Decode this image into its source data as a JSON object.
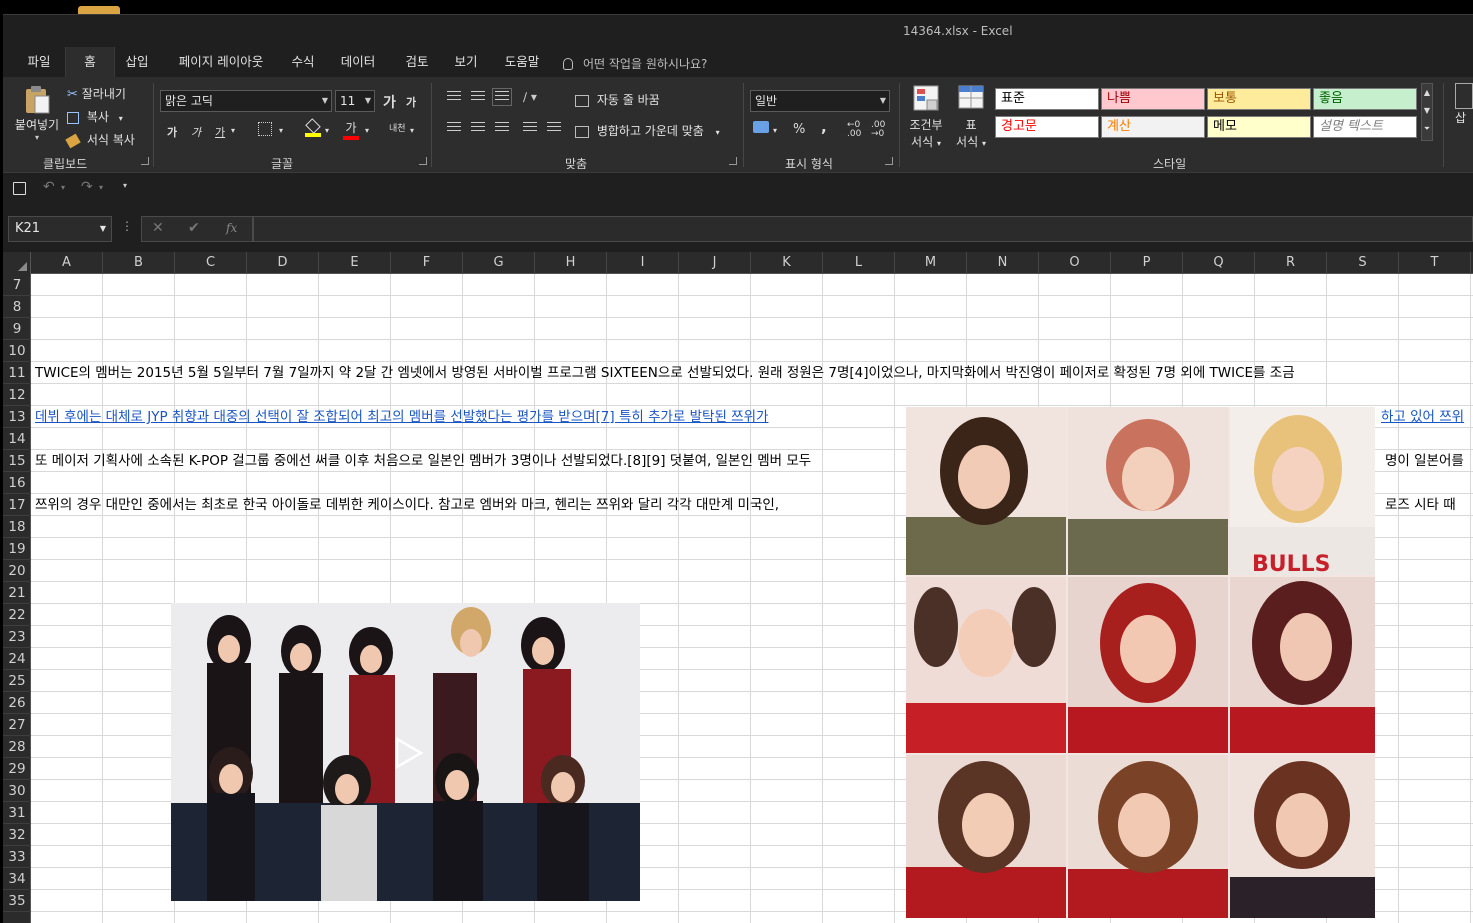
{
  "window": {
    "title": "14364.xlsx  -  Excel"
  },
  "tabs": [
    {
      "label": "파일",
      "active": false
    },
    {
      "label": "홈",
      "active": true
    },
    {
      "label": "삽입",
      "active": false
    },
    {
      "label": "페이지 레이아웃",
      "active": false
    },
    {
      "label": "수식",
      "active": false
    },
    {
      "label": "데이터",
      "active": false
    },
    {
      "label": "검토",
      "active": false
    },
    {
      "label": "보기",
      "active": false
    },
    {
      "label": "도움말",
      "active": false
    }
  ],
  "tell_me": "어떤 작업을 원하시나요?",
  "ribbon": {
    "clipboard": {
      "label": "클립보드",
      "paste": "붙여넣기",
      "cut": "잘라내기",
      "copy": "복사",
      "format_painter": "서식 복사"
    },
    "font": {
      "label": "글꼴",
      "font_name": "맑은 고딕",
      "font_size": "11",
      "grow": "가",
      "shrink": "가",
      "bold": "가",
      "italic": "가",
      "underline": "가",
      "font_color_glyph": "가",
      "phonetic": "내천"
    },
    "alignment": {
      "label": "맞춤",
      "wrap_text": "자동 줄 바꿈",
      "merge_center": "병합하고 가운데 맞춤"
    },
    "number": {
      "label": "표시 형식",
      "format": "일반",
      "percent": "%",
      "comma": ","
    },
    "styles": {
      "label": "스타일",
      "conditional": "조건부",
      "conditional2": "서식",
      "table": "표",
      "table2": "서식",
      "cells": [
        {
          "label": "표준",
          "bg": "#ffffff",
          "fg": "#000000"
        },
        {
          "label": "나쁨",
          "bg": "#ffc7ce",
          "fg": "#9c0006"
        },
        {
          "label": "보통",
          "bg": "#ffeb9c",
          "fg": "#9c5700"
        },
        {
          "label": "좋음",
          "bg": "#c6efce",
          "fg": "#006100"
        },
        {
          "label": "경고문",
          "bg": "#ffffff",
          "fg": "#ff0000"
        },
        {
          "label": "계산",
          "bg": "#f2f2f2",
          "fg": "#fa7d00"
        },
        {
          "label": "메모",
          "bg": "#ffffcc",
          "fg": "#000000"
        },
        {
          "label": "설명 텍스트",
          "bg": "#ffffff",
          "fg": "#7f7f7f"
        }
      ]
    },
    "cells_group": {
      "insert": "삽"
    }
  },
  "formula_bar": {
    "name_box": "K21",
    "fx": "fx",
    "value": ""
  },
  "columns": [
    "A",
    "B",
    "C",
    "D",
    "E",
    "F",
    "G",
    "H",
    "I",
    "J",
    "K",
    "L",
    "M",
    "N",
    "O",
    "P",
    "Q",
    "R",
    "S",
    "T"
  ],
  "rows": [
    "7",
    "8",
    "9",
    "10",
    "11",
    "12",
    "13",
    "14",
    "15",
    "16",
    "17",
    "18",
    "19",
    "20",
    "21",
    "22",
    "23",
    "24",
    "25",
    "26",
    "27",
    "28",
    "29",
    "30",
    "31",
    "32",
    "33",
    "34",
    "35"
  ],
  "cells": {
    "r11": "TWICE의 멤버는 2015년 5월 5일부터 7월 7일까지 약 2달 간 엠넷에서 방영된 서바이벌 프로그램 SIXTEEN으로 선발되었다. 원래 정원은 7명[4]이었으나, 마지막화에서 박진영이 페이저로 확정된 7명 외에 TWICE를 조금",
    "r13a": "데뷔 후에는 대체로 JYP 취향과 대중의 선택이 잘 조합되어 최고의 멤버를 선발했다는 평가를 받으며[7] 특히 추가로 발탁된 쯔위가",
    "r13b": "하고 있어 쯔위",
    "r15a": "또 메이저 기획사에 소속된 K-POP 걸그룹 중에선 써클 이후 처음으로 일본인 멤버가 3명이나 선발되었다.[8][9] 덧붙여, 일본인 멤버 모두",
    "r15b": "명이 일본어를",
    "r17a": "쯔위의 경우 대만인 중에서는 최초로 한국 아이돌로 데뷔한 케이스이다. 참고로 엠버와 마크, 헨리는 쯔위와 달리 각각 대만계 미국인,",
    "r17b": "로즈 시타 때"
  },
  "colors": {
    "accent": "#217346",
    "link": "#1a55c4",
    "font_color_bar": "#ff0000",
    "highlight_bar": "#ffff00"
  }
}
